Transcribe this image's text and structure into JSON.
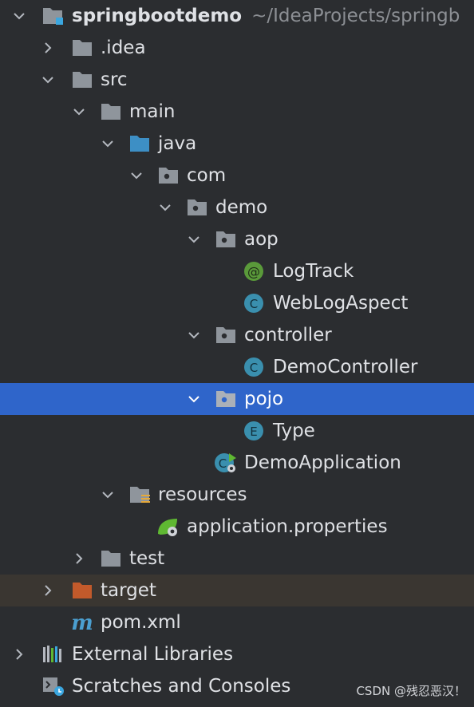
{
  "project": {
    "name": "springbootdemo",
    "path": "~/IdeaProjects/springb"
  },
  "nodes": [
    {
      "label": "springbootdemo",
      "icon": "project-folder-icon",
      "expanded": true
    },
    {
      "label": ".idea",
      "icon": "folder-icon",
      "expanded": false
    },
    {
      "label": "src",
      "icon": "folder-icon",
      "expanded": true
    },
    {
      "label": "main",
      "icon": "folder-icon",
      "expanded": true
    },
    {
      "label": "java",
      "icon": "source-root-folder-icon",
      "expanded": true
    },
    {
      "label": "com",
      "icon": "package-icon",
      "expanded": true
    },
    {
      "label": "demo",
      "icon": "package-icon",
      "expanded": true
    },
    {
      "label": "aop",
      "icon": "package-icon",
      "expanded": true
    },
    {
      "label": "LogTrack",
      "icon": "annotation-icon"
    },
    {
      "label": "WebLogAspect",
      "icon": "class-icon"
    },
    {
      "label": "controller",
      "icon": "package-icon",
      "expanded": true
    },
    {
      "label": "DemoController",
      "icon": "class-icon"
    },
    {
      "label": "pojo",
      "icon": "package-icon",
      "expanded": true,
      "selected": true
    },
    {
      "label": "Type",
      "icon": "enum-icon"
    },
    {
      "label": "DemoApplication",
      "icon": "spring-boot-class-icon"
    },
    {
      "label": "resources",
      "icon": "resources-folder-icon",
      "expanded": true
    },
    {
      "label": "application.properties",
      "icon": "spring-properties-icon"
    },
    {
      "label": "test",
      "icon": "folder-icon",
      "expanded": false
    },
    {
      "label": "target",
      "icon": "excluded-folder-icon",
      "expanded": false
    },
    {
      "label": "pom.xml",
      "icon": "maven-icon"
    },
    {
      "label": "External Libraries",
      "icon": "libraries-icon",
      "expanded": false
    },
    {
      "label": "Scratches and Consoles",
      "icon": "scratches-icon"
    }
  ],
  "watermark": "CSDN @残忍恶汉！",
  "colors": {
    "background": "#2b2d30",
    "selection": "#2f65ca",
    "excluded_row": "#3a3631",
    "folder": "#8f959c",
    "source_root": "#3d8fc5",
    "excluded_folder": "#c25a2b",
    "class_icon": "#3a8fae",
    "annotation_icon": "#5a9a3a"
  }
}
